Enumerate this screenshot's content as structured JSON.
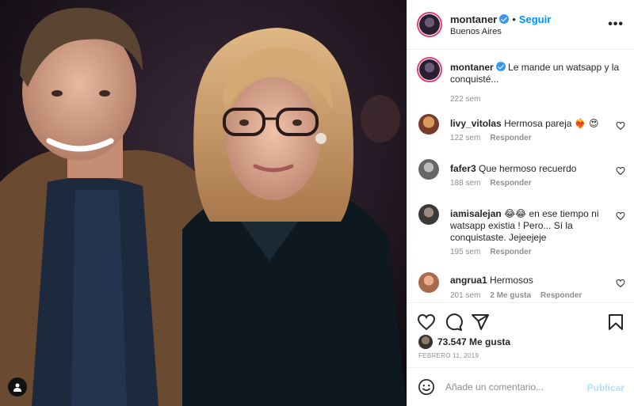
{
  "post": {
    "username": "montaner",
    "follow_label": "Seguir",
    "separator": "•",
    "location": "Buenos Aires",
    "more_label": "•••",
    "caption_text": "Le mande un watsapp y la conquisté...",
    "caption_time": "222 sem",
    "likes": "73.547 Me gusta",
    "date": "Febrero 11, 2019",
    "comment_placeholder": "Añade un comentario...",
    "publish_label": "Publicar"
  },
  "comments": [
    {
      "user": "livy_vitolas",
      "text": "Hermosa pareja ❤️‍🔥 😍",
      "time": "122 sem",
      "likes": "",
      "reply": "Responder"
    },
    {
      "user": "fafer3",
      "text": "Que hermoso recuerdo",
      "time": "188 sem",
      "likes": "",
      "reply": "Responder"
    },
    {
      "user": "iamisalejan",
      "text": "😂😂 en ese tiempo ni watsapp existia ! Pero... Sí la conquistaste. Jejeejeje",
      "time": "195 sem",
      "likes": "",
      "reply": "Responder"
    },
    {
      "user": "angrua1",
      "text": "Hermosos",
      "time": "201 sem",
      "likes": "2 Me gusta",
      "reply": "Responder"
    }
  ],
  "colors": {
    "accent": "#0095f6",
    "verified": "#3897f0",
    "muted": "#8e8e8e",
    "publish_disabled": "#b2dffc"
  },
  "icons": [
    "tag-user-icon",
    "verified-icon",
    "more-options-icon",
    "heart-icon",
    "comment-icon",
    "share-icon",
    "save-icon",
    "emoji-icon"
  ]
}
